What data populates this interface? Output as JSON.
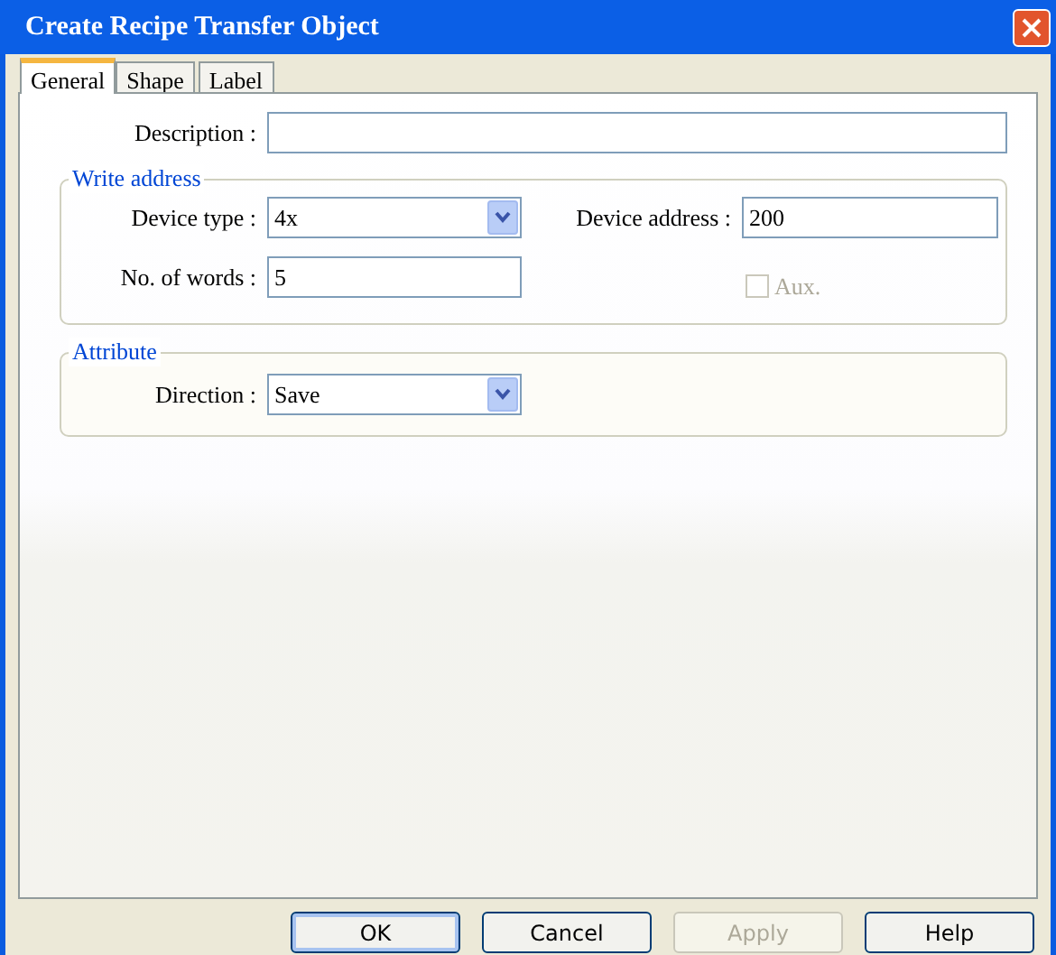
{
  "window": {
    "title": "Create Recipe Transfer Object"
  },
  "tabs": [
    {
      "label": "General",
      "selected": true
    },
    {
      "label": "Shape",
      "selected": false
    },
    {
      "label": "Label",
      "selected": false
    }
  ],
  "description": {
    "label": "Description :"
  },
  "write_address": {
    "title": "Write address",
    "device_type": {
      "label": "Device type :",
      "value": "4x"
    },
    "device_address": {
      "label": "Device address :",
      "value": "200"
    },
    "words": {
      "label": "No. of words :",
      "value": "5"
    },
    "aux": {
      "label": "Aux.",
      "checked": false,
      "disabled": true
    }
  },
  "attribute": {
    "title": "Attribute",
    "direction": {
      "label": "Direction :",
      "value": "Save"
    }
  },
  "buttons": [
    {
      "label": "OK",
      "disabled": false,
      "default": true
    },
    {
      "label": "Cancel",
      "disabled": false,
      "default": false
    },
    {
      "label": "Apply",
      "disabled": true,
      "default": false
    },
    {
      "label": "Help",
      "disabled": false,
      "default": false
    }
  ]
}
